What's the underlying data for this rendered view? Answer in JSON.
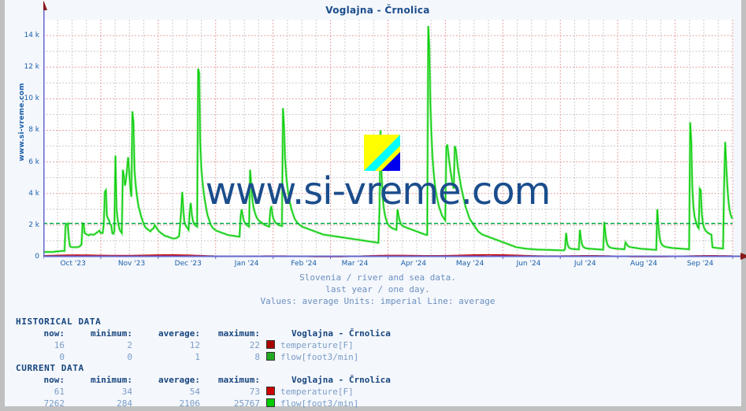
{
  "title": "Voglajna - Črnolica",
  "site_label": "www.si-vreme.com",
  "watermark": "www.si-vreme.com",
  "logo_name": "si-vreme-logo",
  "caption": {
    "line1": "Slovenia / river and sea data.",
    "line2": "last year / one day.",
    "line3": "Values: average  Units: imperial  Line: average"
  },
  "colors": {
    "flow": "#00cc00",
    "temperature": "#cc0000",
    "flow_hist": "#22aa22",
    "temperature_hist": "#aa0000",
    "axis": "#6666cc",
    "text_blue": "#1b4d8c",
    "value_blue": "#7b9dc7",
    "grid_major": "#e8a0a0",
    "grid_minor": "#cccccc",
    "avg_line": "#00aa44"
  },
  "tables": [
    {
      "section": "HISTORICAL DATA",
      "headers": [
        "now:",
        "minimum:",
        "average:",
        "maximum:",
        "Voglajna - Črnolica"
      ],
      "rows": [
        {
          "now": "16",
          "minimum": "2",
          "average": "12",
          "maximum": "22",
          "color": "#aa0000",
          "series": "temperature[F]"
        },
        {
          "now": "0",
          "minimum": "0",
          "average": "1",
          "maximum": "8",
          "color": "#22aa22",
          "series": "flow[foot3/min]"
        }
      ]
    },
    {
      "section": "CURRENT DATA",
      "headers": [
        "now:",
        "minimum:",
        "average:",
        "maximum:",
        "Voglajna - Črnolica"
      ],
      "rows": [
        {
          "now": "61",
          "minimum": "34",
          "average": "54",
          "maximum": "73",
          "color": "#cc0000",
          "series": "temperature[F]"
        },
        {
          "now": "7262",
          "minimum": "284",
          "average": "2106",
          "maximum": "25767",
          "color": "#00cc00",
          "series": "flow[foot3/min]"
        }
      ]
    }
  ],
  "chart_data": {
    "type": "line",
    "title": "Voglajna - Črnolica",
    "xlabel": "",
    "ylabel": "",
    "ylim": [
      0,
      15000
    ],
    "yticks": [
      0,
      2000,
      4000,
      6000,
      8000,
      10000,
      12000,
      14000
    ],
    "ytick_labels": [
      "0",
      "2 k",
      "4 k",
      "6 k",
      "8 k",
      "10 k",
      "12 k",
      "14 k"
    ],
    "grid": true,
    "legend": "none",
    "x_tick_labels": [
      "Oct '23",
      "Nov '23",
      "Dec '23",
      "Jan '24",
      "Feb '24",
      "Mar '24",
      "Apr '24",
      "May '24",
      "Jun '24",
      "Jul '24",
      "Aug '24",
      "Sep '24"
    ],
    "x_tick_positions": [
      0.043,
      0.128,
      0.21,
      0.295,
      0.378,
      0.452,
      0.537,
      0.619,
      0.704,
      0.786,
      0.871,
      0.953
    ],
    "average_line": {
      "value": 2106,
      "color": "#00aa44",
      "style": "dashed"
    },
    "series": [
      {
        "name": "flow[foot3/min]",
        "color": "#00cc00",
        "unit": "foot3/min",
        "now": 7262,
        "minimum": 284,
        "average": 2106,
        "maximum": 25767,
        "values": [
          300,
          300,
          300,
          300,
          300,
          300,
          300,
          300,
          300,
          300,
          300,
          320,
          330,
          330,
          330,
          340,
          350,
          360,
          360,
          360,
          360,
          2000,
          2050,
          2100,
          1200,
          700,
          620,
          600,
          600,
          600,
          600,
          600,
          600,
          620,
          640,
          700,
          780,
          2100,
          2050,
          1500,
          1450,
          1400,
          1380,
          1350,
          1400,
          1420,
          1400,
          1380,
          1400,
          1450,
          1500,
          1550,
          1600,
          1650,
          1500,
          1500,
          1500,
          2050,
          4100,
          4200,
          2600,
          2400,
          2300,
          2050,
          2000,
          1500,
          1450,
          1600,
          6400,
          3100,
          2400,
          2000,
          1700,
          1600,
          1500,
          5500,
          5100,
          4500,
          4900,
          5600,
          6300,
          5300,
          4400,
          3800,
          9200,
          8500,
          5500,
          4600,
          4000,
          3500,
          3100,
          2900,
          2600,
          2400,
          2200,
          2000,
          1900,
          1800,
          1750,
          1700,
          1650,
          1600,
          1700,
          1750,
          1800,
          2000,
          1900,
          1800,
          1700,
          1600,
          1550,
          1500,
          1450,
          1400,
          1350,
          1300,
          1300,
          1280,
          1250,
          1220,
          1200,
          1180,
          1150,
          1150,
          1150,
          1170,
          1200,
          1250,
          1300,
          2000,
          2900,
          4100,
          3000,
          2200,
          2000,
          1900,
          1800,
          1700,
          2800,
          3400,
          2700,
          2300,
          2100,
          2000,
          1950,
          1900,
          11900,
          11600,
          7200,
          5600,
          4800,
          4200,
          3700,
          3300,
          2900,
          2600,
          2400,
          2200,
          2000,
          1900,
          1800,
          1750,
          1700,
          1650,
          1620,
          1600,
          1580,
          1550,
          1520,
          1500,
          1480,
          1450,
          1420,
          1400,
          1380,
          1360,
          1350,
          1340,
          1330,
          1320,
          1310,
          1300,
          1290,
          1280,
          1270,
          1260,
          2500,
          3000,
          2600,
          2300,
          2150,
          2050,
          2000,
          1950,
          1900,
          5500,
          4600,
          3700,
          3200,
          2900,
          2700,
          2500,
          2400,
          2300,
          2250,
          2200,
          2150,
          2100,
          2050,
          2000,
          1980,
          1950,
          1920,
          1900,
          2900,
          3200,
          2700,
          2400,
          2250,
          2150,
          2100,
          2050,
          2000,
          1980,
          1960,
          1940,
          9400,
          8200,
          6200,
          5200,
          4500,
          4000,
          3600,
          3300,
          3000,
          2800,
          2600,
          2400,
          2300,
          2200,
          2100,
          2050,
          2000,
          1950,
          1900,
          1880,
          1850,
          1820,
          1800,
          1780,
          1750,
          1720,
          1700,
          1680,
          1650,
          1620,
          1600,
          1580,
          1550,
          1520,
          1500,
          1480,
          1450,
          1420,
          1400,
          1390,
          1380,
          1370,
          1360,
          1350,
          1340,
          1330,
          1320,
          1310,
          1300,
          1290,
          1280,
          1270,
          1260,
          1250,
          1240,
          1230,
          1220,
          1210,
          1200,
          1190,
          1180,
          1170,
          1160,
          1150,
          1140,
          1130,
          1120,
          1110,
          1100,
          1090,
          1080,
          1070,
          1060,
          1050,
          1040,
          1030,
          1020,
          1010,
          1000,
          990,
          980,
          970,
          960,
          950,
          940,
          930,
          920,
          910,
          900,
          890,
          880,
          3000,
          8000,
          5200,
          3800,
          3100,
          2700,
          2400,
          2200,
          2050,
          1950,
          1900,
          1850,
          1800,
          1780,
          1750,
          1720,
          1700,
          3000,
          2600,
          2300,
          2100,
          2000,
          1950,
          1900,
          1880,
          1850,
          1820,
          1800,
          1780,
          1750,
          1720,
          1700,
          1680,
          1650,
          1620,
          1600,
          1580,
          1550,
          1520,
          1500,
          1480,
          1450,
          1420,
          1400,
          1390,
          1380,
          14600,
          13200,
          9800,
          7700,
          6300,
          5400,
          4700,
          4200,
          3800,
          3500,
          3200,
          3000,
          2800,
          2600,
          2500,
          2400,
          2300,
          6900,
          7100,
          6500,
          5900,
          5400,
          5000,
          4600,
          4300,
          7000,
          6800,
          6200,
          5600,
          5200,
          4800,
          4400,
          4100,
          3800,
          3500,
          3200,
          3000,
          2800,
          2600,
          2400,
          2300,
          2200,
          2100,
          2000,
          1900,
          1800,
          1700,
          1600,
          1550,
          1500,
          1450,
          1400,
          1380,
          1350,
          1320,
          1300,
          1280,
          1250,
          1220,
          1200,
          1180,
          1150,
          1120,
          1100,
          1080,
          1050,
          1020,
          1000,
          980,
          950,
          920,
          900,
          880,
          850,
          820,
          800,
          780,
          750,
          720,
          700,
          680,
          650,
          620,
          600,
          590,
          580,
          570,
          560,
          550,
          540,
          530,
          520,
          510,
          500,
          495,
          490,
          485,
          480,
          475,
          470,
          465,
          460,
          455,
          450,
          448,
          446,
          444,
          442,
          440,
          438,
          436,
          434,
          432,
          430,
          428,
          426,
          424,
          422,
          420,
          418,
          416,
          414,
          412,
          410,
          408,
          406,
          404,
          402,
          400,
          500,
          1500,
          900,
          650,
          560,
          520,
          500,
          490,
          485,
          480,
          475,
          470,
          465,
          460,
          1700,
          1100,
          780,
          640,
          580,
          550,
          530,
          520,
          510,
          505,
          500,
          495,
          490,
          485,
          480,
          475,
          470,
          465,
          460,
          455,
          450,
          445,
          440,
          2200,
          1500,
          1000,
          760,
          660,
          600,
          570,
          550,
          540,
          530,
          520,
          510,
          505,
          500,
          495,
          490,
          485,
          480,
          475,
          470,
          900,
          800,
          700,
          650,
          620,
          600,
          590,
          580,
          570,
          560,
          550,
          540,
          530,
          520,
          510,
          500,
          495,
          490,
          485,
          480,
          475,
          470,
          465,
          460,
          455,
          450,
          445,
          440,
          435,
          430,
          3000,
          2000,
          1300,
          950,
          800,
          720,
          670,
          640,
          620,
          600,
          590,
          580,
          570,
          560,
          550,
          545,
          540,
          535,
          530,
          525,
          520,
          515,
          510,
          505,
          500,
          495,
          490,
          485,
          480,
          475,
          470,
          8500,
          7300,
          4400,
          3200,
          2600,
          2300,
          2100,
          1900,
          1800,
          4300,
          4200,
          2700,
          2100,
          1850,
          1700,
          1620,
          1550,
          1500,
          1460,
          1420,
          1400,
          600,
          580,
          570,
          560,
          550,
          545,
          540,
          535,
          530,
          525,
          520,
          4600,
          7262,
          5800,
          4500,
          3600,
          3000,
          2700,
          2500,
          2400
        ]
      },
      {
        "name": "temperature[F]",
        "color": "#cc0000",
        "unit": "F",
        "now": 61,
        "minimum": 34,
        "average": 54,
        "maximum": 73,
        "note": "Plotted on the same 0..15000 axis so the curve renders as a near-flat line just above zero."
      }
    ]
  }
}
